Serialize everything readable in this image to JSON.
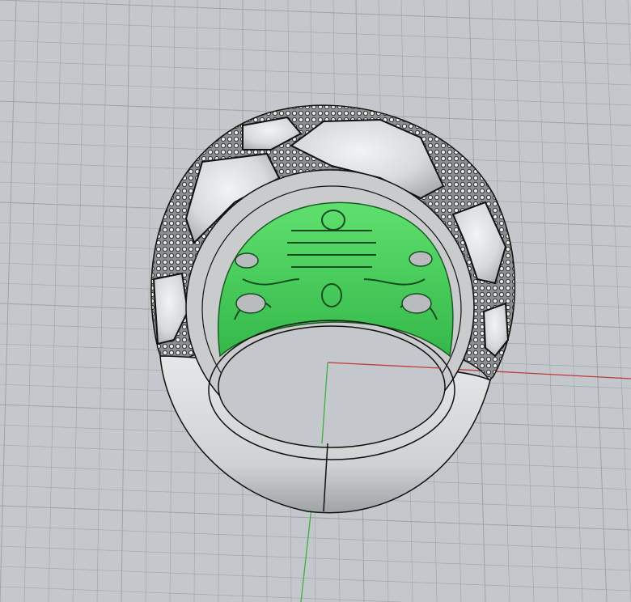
{
  "viewport": {
    "background_color": "#c4c8cc",
    "grid_color": "#9ea3a8",
    "x_axis_color": "#c23a3a",
    "y_axis_color": "#3fae3a"
  },
  "model": {
    "metal_color": "#d5d7d9",
    "edge_color": "#1a1a1a",
    "selection_color": "#45d45a",
    "selected_part": "inner-filigree"
  }
}
